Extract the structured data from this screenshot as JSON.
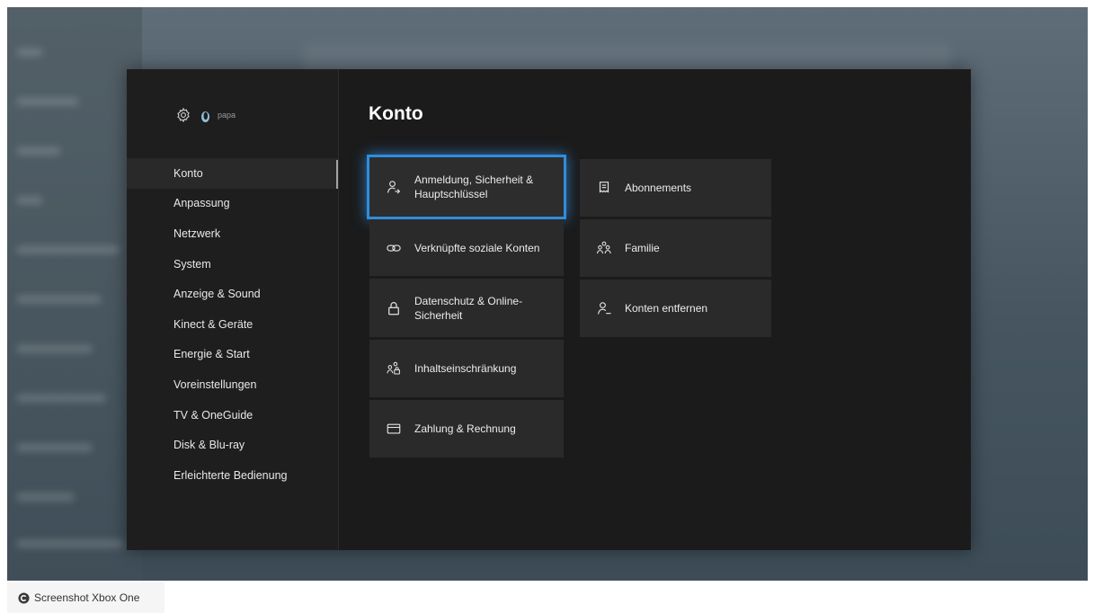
{
  "user": {
    "name": "papa"
  },
  "sidebar": {
    "items": [
      {
        "label": "Konto"
      },
      {
        "label": "Anpassung"
      },
      {
        "label": "Netzwerk"
      },
      {
        "label": "System"
      },
      {
        "label": "Anzeige & Sound"
      },
      {
        "label": "Kinect & Geräte"
      },
      {
        "label": "Energie & Start"
      },
      {
        "label": "Voreinstellungen"
      },
      {
        "label": "TV & OneGuide"
      },
      {
        "label": "Disk & Blu-ray"
      },
      {
        "label": "Erleichterte Bedienung"
      }
    ],
    "selected": "Konto"
  },
  "main": {
    "title": "Konto",
    "tiles": [
      {
        "label": "Anmeldung, Sicherheit & Hauptschlüssel",
        "icon": "person-key-icon",
        "focused": true
      },
      {
        "label": "Verknüpfte soziale Konten",
        "icon": "link-icon"
      },
      {
        "label": "Datenschutz & Online-Sicherheit",
        "icon": "lock-icon"
      },
      {
        "label": "Inhaltseinschränkung",
        "icon": "family-lock-icon"
      },
      {
        "label": "Zahlung & Rechnung",
        "icon": "credit-card-icon"
      },
      {
        "label": "Abonnements",
        "icon": "subscriptions-icon"
      },
      {
        "label": "Familie",
        "icon": "family-icon"
      },
      {
        "label": "Konten entfernen",
        "icon": "remove-account-icon"
      }
    ]
  },
  "caption": {
    "text": "Screenshot Xbox One"
  },
  "colors": {
    "focus": "#2f8dde",
    "dialog": "#1b1b1b",
    "tile": "#2a2a2a"
  }
}
